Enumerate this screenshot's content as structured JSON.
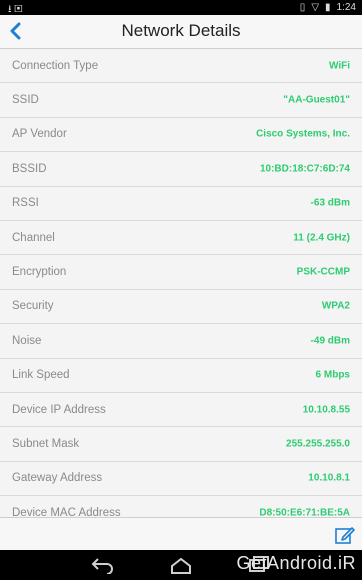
{
  "status_bar": {
    "time": "1:24"
  },
  "header": {
    "title": "Network Details"
  },
  "rows": [
    {
      "label": "Connection Type",
      "value": "WiFi"
    },
    {
      "label": "SSID",
      "value": "\"AA-Guest01\""
    },
    {
      "label": "AP Vendor",
      "value": "Cisco Systems, Inc."
    },
    {
      "label": "BSSID",
      "value": "10:BD:18:C7:6D:74"
    },
    {
      "label": "RSSI",
      "value": "-63 dBm"
    },
    {
      "label": "Channel",
      "value": "11 (2.4 GHz)"
    },
    {
      "label": "Encryption",
      "value": "PSK-CCMP"
    },
    {
      "label": "Security",
      "value": "WPA2"
    },
    {
      "label": "Noise",
      "value": "-49 dBm"
    },
    {
      "label": "Link Speed",
      "value": "6 Mbps"
    },
    {
      "label": "Device IP Address",
      "value": "10.10.8.55"
    },
    {
      "label": "Subnet Mask",
      "value": "255.255.255.0"
    },
    {
      "label": "Gateway Address",
      "value": "10.10.8.1"
    },
    {
      "label": "Device MAC Address",
      "value": "D8:50:E6:71:BE:5A"
    }
  ],
  "watermark": "GetAndroid.iR",
  "colors": {
    "accent": "#1e7fd6",
    "value_green": "#2ecc71"
  }
}
